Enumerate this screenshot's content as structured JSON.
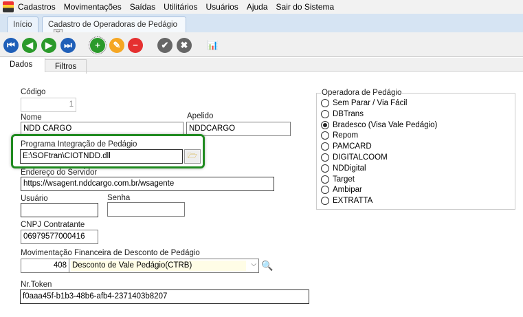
{
  "menu": [
    "Cadastros",
    "Movimentações",
    "Saídas",
    "Utilitários",
    "Usuários",
    "Ajuda",
    "Sair do Sistema"
  ],
  "tabs": {
    "home": "Início",
    "active": "Cadastro de Operadoras de Pedágio"
  },
  "toolbar": {
    "first": "first-icon",
    "prev": "prev-icon",
    "next": "next-icon",
    "last": "last-icon",
    "add": "add-icon",
    "edit": "edit-icon",
    "delete": "delete-icon",
    "confirm": "confirm-icon",
    "cancel": "cancel-icon",
    "report": "report-icon"
  },
  "page_tabs": [
    "Dados",
    "Filtros"
  ],
  "form": {
    "codigo_label": "Código",
    "codigo": "1",
    "nome_label": "Nome",
    "nome": "NDD CARGO",
    "apelido_label": "Apelido",
    "apelido": "NDDCARGO",
    "programa_label": "Programa Integração de Pedágio",
    "programa": "E:\\SOFtran\\CIOTNDD.dll",
    "endereco_label": "Endereço do Servidor",
    "endereco": "https://wsagent.nddcargo.com.br/wsagente",
    "usuario_label": "Usuário",
    "usuario": "",
    "senha_label": "Senha",
    "senha": "",
    "cnpj_label": "CNPJ Contratante",
    "cnpj": "06979577000416",
    "mov_label": "Movimentação Financeira de Desconto de Pedágio",
    "mov_code": "408",
    "mov_desc": "Desconto de Vale Pedágio(CTRB)",
    "token_label": "Nr.Token",
    "token": "f0aaa45f-b1b3-48b6-afb4-2371403b8207"
  },
  "operadora": {
    "title": "Operadora de Pedágio",
    "selected": 2,
    "options": [
      "Sem Parar / Via Fácil",
      "DBTrans",
      "Bradesco (Visa Vale Pedágio)",
      "Repom",
      "PAMCARD",
      "DIGITALCOOM",
      "NDDigital",
      "Target",
      "Ambipar",
      "EXTRATTA"
    ]
  },
  "colors": {
    "highlight": "#1f8a1f",
    "combo_bg": "#fffde6"
  }
}
